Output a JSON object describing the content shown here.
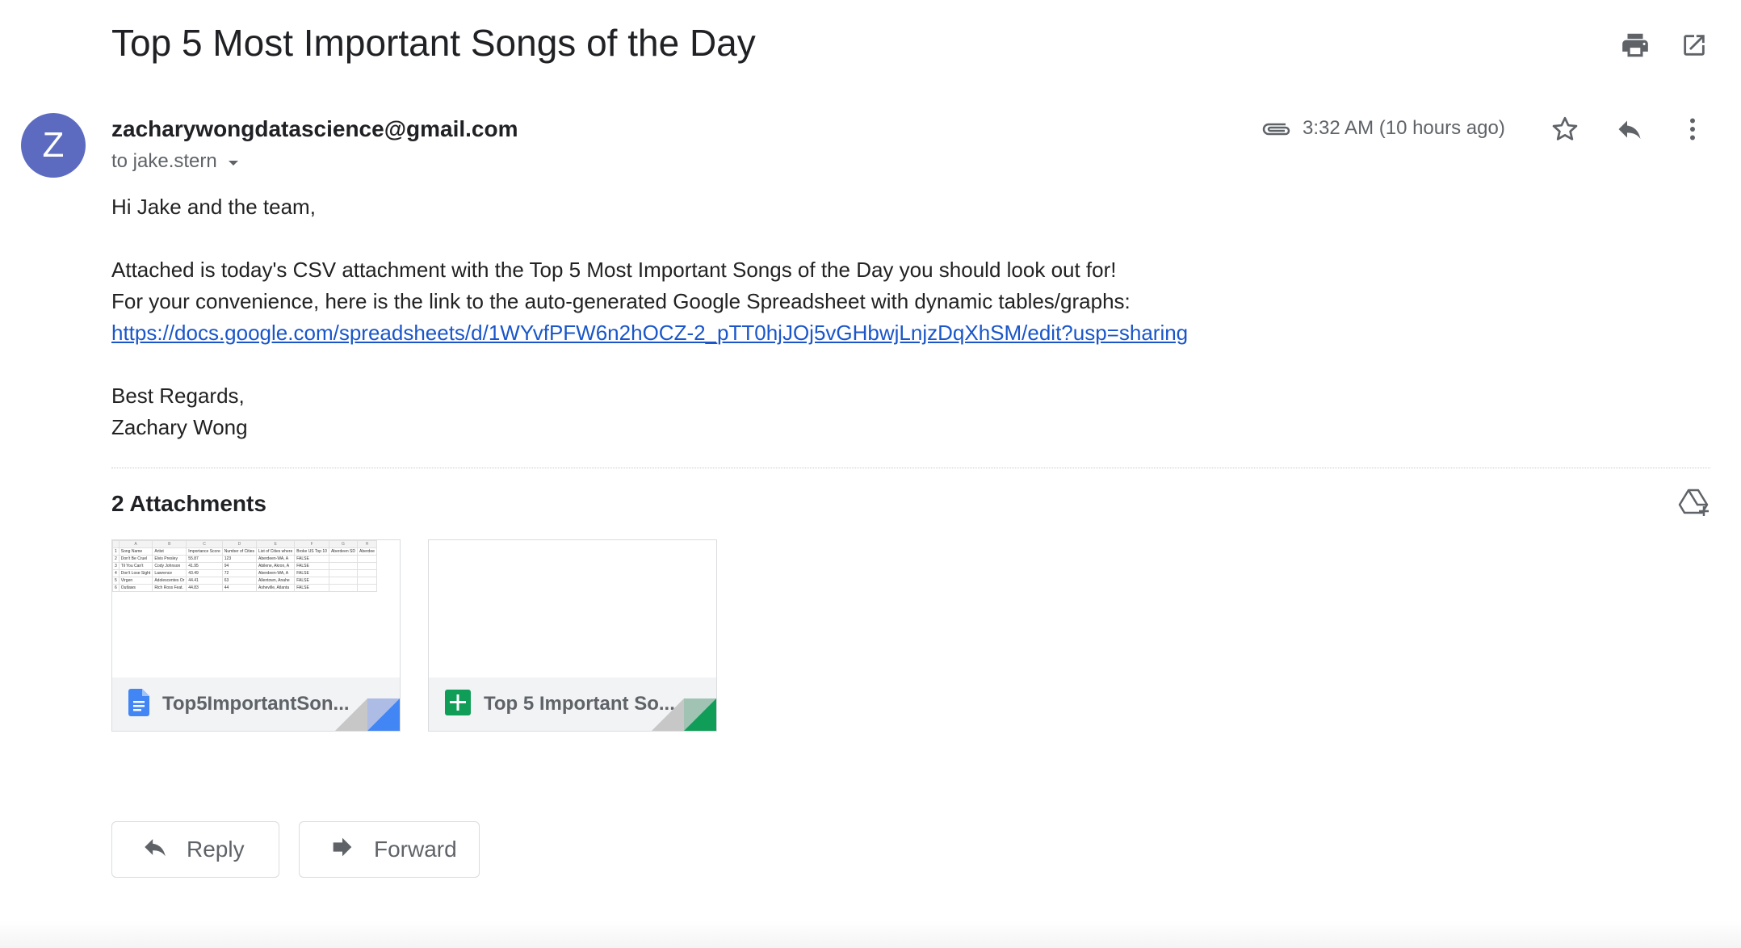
{
  "email": {
    "subject": "Top 5 Most Important Songs of the Day",
    "sender_initial": "Z",
    "sender": "zacharywongdatascience@gmail.com",
    "to": "to jake.stern",
    "time": "3:32 AM (10 hours ago)",
    "body": {
      "greeting": "Hi Jake and the team,",
      "line1": "Attached is today's CSV attachment with the Top 5 Most Important Songs of the Day you should look out for!",
      "line2": "For your convenience, here is the link to the auto-generated Google Spreadsheet with dynamic tables/graphs:",
      "link": "https://docs.google.com/spreadsheets/d/1WYvfPFW6n2hOCZ-2_pTT0hjJOj5vGHbwjLnjzDqXhSM/edit?usp=sharing",
      "closing": "Best Regards,",
      "signature": "Zachary Wong"
    }
  },
  "attachments": {
    "title": "2 Attachments",
    "items": [
      {
        "name": "Top5ImportantSon...",
        "type": "docs",
        "color": "#4285f4"
      },
      {
        "name": "Top 5 Important So...",
        "type": "sheets",
        "color": "#0f9d58"
      }
    ],
    "preview": {
      "col_letters": [
        "",
        "A",
        "B",
        "C",
        "D",
        "E",
        "F",
        "G",
        "H"
      ],
      "headers": [
        "1",
        "Song Name",
        "Artist",
        "Importance Score",
        "Number of Cities",
        "List of Cities where",
        "Broke US Top 10",
        "Aberdeen SD",
        "Aberdee"
      ],
      "rows": [
        [
          "2",
          "Don't Be Cruel",
          "Elvis Presley",
          "55.87",
          "123",
          "Aberdeen-WA, A",
          "FALSE",
          "",
          ""
        ],
        [
          "3",
          "Til You Can't",
          "Cody Johnson",
          "41.95",
          "94",
          "Abilene, Akron, A",
          "FALSE",
          "",
          ""
        ],
        [
          "4",
          "Don't Lose Sight",
          "Lawrence",
          "43.49",
          "72",
          "Aberdeen-WA, A",
          "FALSE",
          "",
          ""
        ],
        [
          "5",
          "Virgen",
          "Adolescentes Or",
          "44.41",
          "63",
          "Allentown, Anahe",
          "FALSE",
          "",
          ""
        ],
        [
          "6",
          "Outlaws",
          "Rich Ross Feat.",
          "44.83",
          "44",
          "Asheville, Atlanta",
          "FALSE",
          "",
          ""
        ]
      ]
    }
  },
  "actions": {
    "reply": "Reply",
    "forward": "Forward"
  },
  "colors": {
    "avatar": "#5c6bc0",
    "link": "#1a56c9",
    "icon": "#5f6368"
  },
  "icons": [
    "print-icon",
    "open-in-new-window-icon",
    "attachment-clip-icon",
    "star-icon",
    "reply-icon",
    "more-vert-icon",
    "save-to-drive-icon",
    "docs-icon",
    "sheets-icon",
    "forward-icon"
  ]
}
